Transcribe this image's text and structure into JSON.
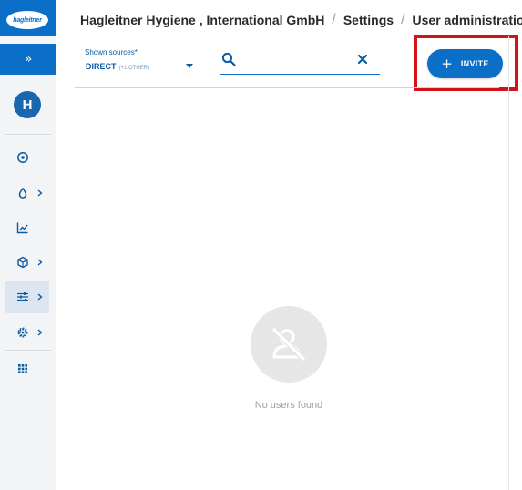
{
  "sidebar": {
    "logo_text": "hagleitner",
    "expand_glyph": "»",
    "avatar_initial": "H",
    "items": [
      {
        "icon": "dashboard-icon",
        "has_submenu": false,
        "active": false
      },
      {
        "icon": "drop-icon",
        "has_submenu": true,
        "active": false
      },
      {
        "icon": "chart-icon",
        "has_submenu": false,
        "active": false
      },
      {
        "icon": "cube-icon",
        "has_submenu": true,
        "active": false
      },
      {
        "icon": "sliders-icon",
        "has_submenu": true,
        "active": true
      },
      {
        "icon": "gear-icon",
        "has_submenu": true,
        "active": false
      },
      {
        "icon": "apps-grid-icon",
        "has_submenu": false,
        "active": false
      }
    ]
  },
  "breadcrumb": {
    "org": "Hagleitner Hygiene , International GmbH",
    "section": "Settings",
    "page": "User administration",
    "separator": "/"
  },
  "toolbar": {
    "source_label": "Shown sources*",
    "source_value": "DIRECT",
    "source_extra": "(+1 OTHER)",
    "search_value": "",
    "invite_label": "INVITE",
    "invite_plus": "+"
  },
  "empty_state": {
    "message": "No users found"
  },
  "colors": {
    "primary": "#0b6fc7",
    "highlight_frame": "#d3121a",
    "empty_circle": "#e6e6e6"
  }
}
